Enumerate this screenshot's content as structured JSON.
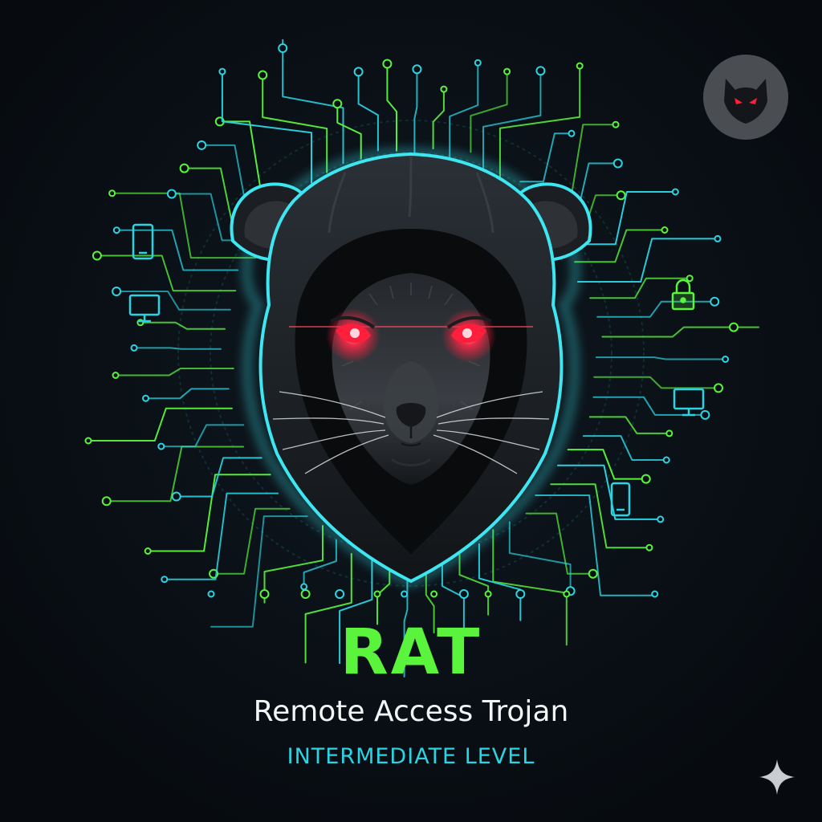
{
  "title": "RAT",
  "subtitle": "Remote Access Trojan",
  "level": "INTERMEDIATE LEVEL",
  "colors": {
    "background": "#0b1016",
    "accent_green": "#5af43c",
    "accent_cyan": "#2bd4e2",
    "eye_red": "#ff1e3c",
    "hood_outline": "#3de6f0"
  },
  "icons": {
    "corner_badge": "wolf-head-icon",
    "sparkle": "sparkle-icon",
    "devices": [
      "smartphone-icon",
      "monitor-icon",
      "lock-icon",
      "monitor-icon",
      "smartphone-icon"
    ]
  }
}
